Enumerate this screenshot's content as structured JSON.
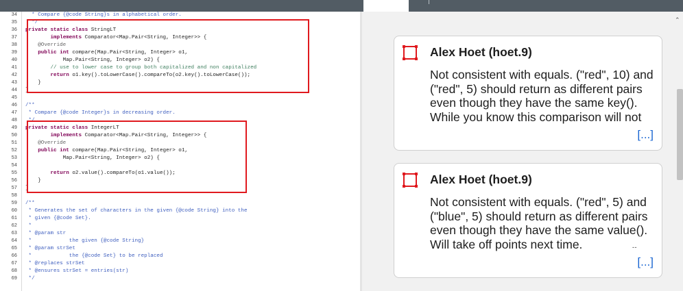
{
  "editor": {
    "lines": [
      {
        "n": "34",
        "text": "  * Compare {@code String}s in alphabetical order.",
        "style": "doc"
      },
      {
        "n": "35",
        "text": "  */",
        "style": "doc"
      },
      {
        "n": "36",
        "text": "private static class StringLT",
        "style": "decl"
      },
      {
        "n": "37",
        "text": "        implements Comparator<Map.Pair<String, Integer>> {",
        "style": "impl"
      },
      {
        "n": "38",
        "text": "    @Override",
        "style": "an"
      },
      {
        "n": "39",
        "text": "    public int compare(Map.Pair<String, Integer> o1,",
        "style": "pub"
      },
      {
        "n": "40",
        "text": "            Map.Pair<String, Integer> o2) {",
        "style": "plain"
      },
      {
        "n": "41",
        "text": "        // use to lower case to group both capitalized and non capitalized",
        "style": "cm"
      },
      {
        "n": "42",
        "text": "        return o1.key().toLowerCase().compareTo(o2.key().toLowerCase());",
        "style": "ret"
      },
      {
        "n": "43",
        "text": "    }",
        "style": "plain"
      },
      {
        "n": "44",
        "text": "}",
        "style": "plain"
      },
      {
        "n": "45",
        "text": "",
        "style": "plain"
      },
      {
        "n": "46",
        "text": "/**",
        "style": "doc"
      },
      {
        "n": "47",
        "text": " * Compare {@code Integer}s in decreasing order.",
        "style": "doc"
      },
      {
        "n": "48",
        "text": " */",
        "style": "doc"
      },
      {
        "n": "49",
        "text": "private static class IntegerLT",
        "style": "decl"
      },
      {
        "n": "50",
        "text": "        implements Comparator<Map.Pair<String, Integer>> {",
        "style": "impl"
      },
      {
        "n": "51",
        "text": "    @Override",
        "style": "an"
      },
      {
        "n": "52",
        "text": "    public int compare(Map.Pair<String, Integer> o1,",
        "style": "pub"
      },
      {
        "n": "53",
        "text": "            Map.Pair<String, Integer> o2) {",
        "style": "plain"
      },
      {
        "n": "54",
        "text": "",
        "style": "plain"
      },
      {
        "n": "55",
        "text": "        return o2.value().compareTo(o1.value());",
        "style": "ret"
      },
      {
        "n": "56",
        "text": "    }",
        "style": "plain"
      },
      {
        "n": "57",
        "text": "}",
        "style": "plain"
      },
      {
        "n": "58",
        "text": "",
        "style": "plain"
      },
      {
        "n": "59",
        "text": "/**",
        "style": "doc"
      },
      {
        "n": "60",
        "text": " * Generates the set of characters in the given {@code String} into the",
        "style": "doc"
      },
      {
        "n": "61",
        "text": " * given {@code Set}.",
        "style": "doc"
      },
      {
        "n": "62",
        "text": " *",
        "style": "doc"
      },
      {
        "n": "63",
        "text": " * @param str",
        "style": "doc"
      },
      {
        "n": "64",
        "text": " *            the given {@code String}",
        "style": "doc"
      },
      {
        "n": "65",
        "text": " * @param strSet",
        "style": "doc"
      },
      {
        "n": "66",
        "text": " *            the {@code Set} to be replaced",
        "style": "doc"
      },
      {
        "n": "67",
        "text": " * @replaces strSet",
        "style": "doc"
      },
      {
        "n": "68",
        "text": " * @ensures strSet = entries(str)",
        "style": "doc"
      },
      {
        "n": "69",
        "text": " */",
        "style": "doc"
      }
    ]
  },
  "comments": [
    {
      "author": "Alex Hoet (hoet.9)",
      "body": "Not consistent with equals. (\"red\", 10) and (\"red\", 5) should return as different pairs even though they have the same key(). While you know this comparison will not",
      "more": "[...]"
    },
    {
      "author": "Alex Hoet (hoet.9)",
      "body": "Not consistent with equals. (\"red\", 5) and (\"blue\", 5) should return as different pairs even though they have the same value(). Will take off points next time.",
      "more": "[...]"
    }
  ],
  "colors": {
    "highlight": "#e0191e",
    "link": "#1a66d2",
    "toolbar": "#525c64"
  }
}
